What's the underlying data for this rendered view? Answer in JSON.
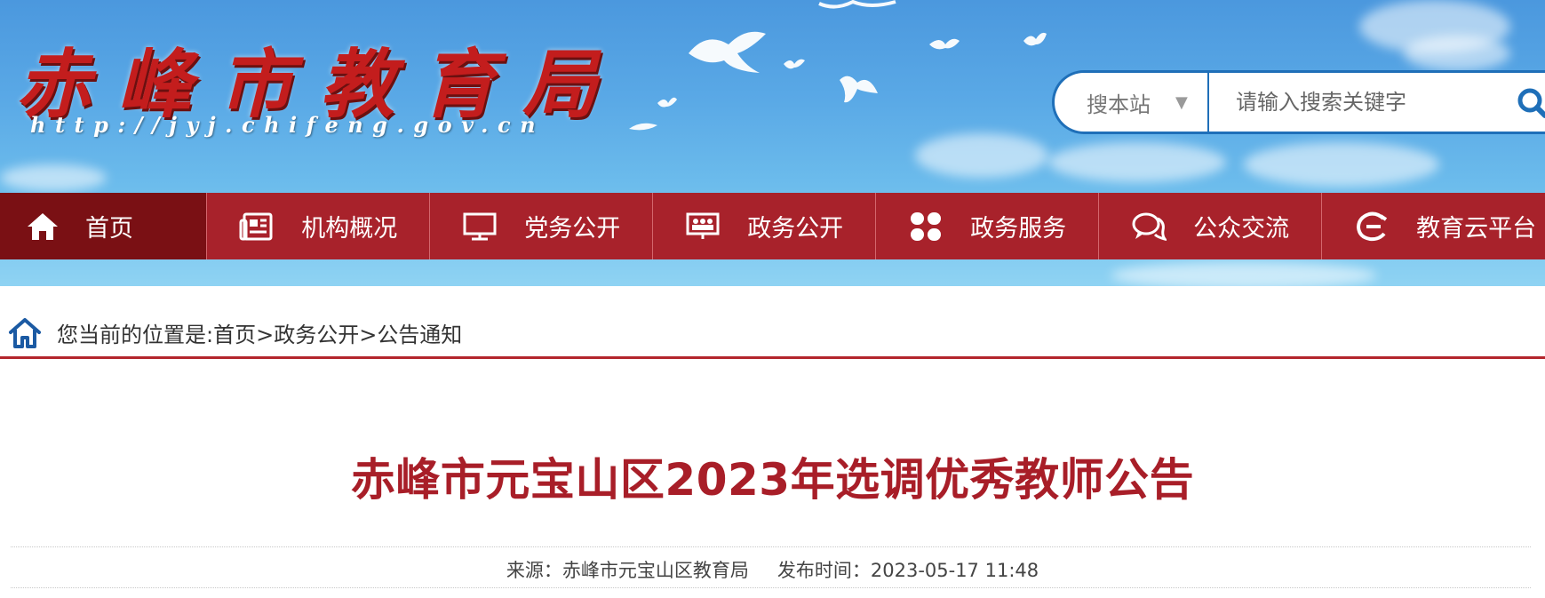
{
  "header": {
    "logo_title": "赤峰市教育局",
    "logo_url": "http://jyj.chifeng.gov.cn"
  },
  "search": {
    "scope_label": "搜本站",
    "placeholder": "请输入搜索关键字",
    "icon": "search-icon"
  },
  "nav": {
    "items": [
      {
        "label": "首页",
        "icon": "home-icon"
      },
      {
        "label": "机构概况",
        "icon": "newspaper-icon"
      },
      {
        "label": "党务公开",
        "icon": "monitor-icon"
      },
      {
        "label": "政务公开",
        "icon": "people-board-icon"
      },
      {
        "label": "政务服务",
        "icon": "grid-icon"
      },
      {
        "label": "公众交流",
        "icon": "chat-icon"
      },
      {
        "label": "教育云平台",
        "icon": "cloud-e-icon"
      }
    ]
  },
  "breadcrumb": {
    "prefix": "您当前的位置是:",
    "items": [
      "首页",
      "政务公开",
      "公告通知"
    ],
    "separator": ">"
  },
  "article": {
    "title": "赤峰市元宝山区2023年选调优秀教师公告",
    "source": "来源：赤峰市元宝山区教育局",
    "published": "发布时间：2023-05-17 11:48"
  },
  "colors": {
    "nav_bg": "#a8222b",
    "nav_active_bg": "#7a1014",
    "title_red": "#a81e28",
    "search_border": "#1f6fb8"
  }
}
